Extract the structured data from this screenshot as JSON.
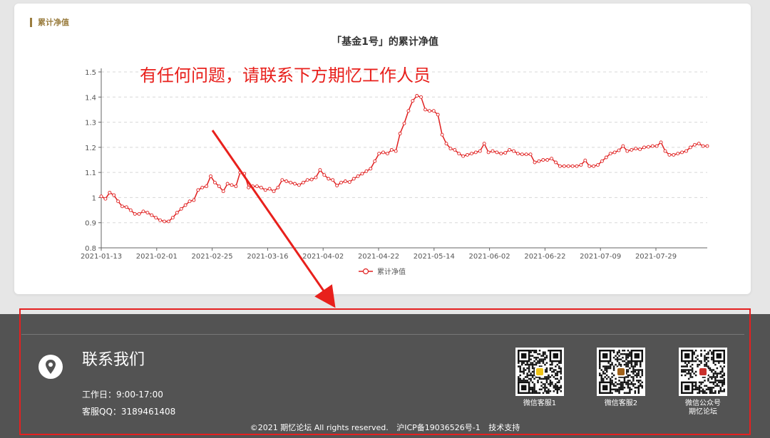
{
  "section": {
    "heading": "累计净值"
  },
  "annotation": {
    "text": "有任何问题，请联系下方期忆工作人员"
  },
  "colors": {
    "line": "#e02020",
    "accent": "#9a7d3f",
    "footer_bg": "#535353",
    "annotation": "#e8201c"
  },
  "chart_data": {
    "type": "line",
    "title": "「基金1号」的累计净值",
    "xlabel": "",
    "ylabel": "",
    "ylim": [
      0.8,
      1.5
    ],
    "yticks": [
      0.8,
      0.9,
      1,
      1.1,
      1.2,
      1.3,
      1.4,
      1.5
    ],
    "xticks": [
      "2021-01-13",
      "2021-02-01",
      "2021-02-25",
      "2021-03-16",
      "2021-04-02",
      "2021-04-22",
      "2021-05-14",
      "2021-06-02",
      "2021-06-22",
      "2021-07-09",
      "2021-07-29"
    ],
    "grid": true,
    "legend": "bottom-center",
    "series": [
      {
        "name": "累计净值",
        "values": [
          1.005,
          0.995,
          1.02,
          1.01,
          0.985,
          0.965,
          0.962,
          0.95,
          0.935,
          0.935,
          0.945,
          0.94,
          0.93,
          0.92,
          0.91,
          0.905,
          0.905,
          0.92,
          0.94,
          0.955,
          0.97,
          0.985,
          0.99,
          1.03,
          1.04,
          1.045,
          1.085,
          1.06,
          1.045,
          1.025,
          1.055,
          1.05,
          1.045,
          1.1,
          1.095,
          1.04,
          1.045,
          1.045,
          1.04,
          1.03,
          1.035,
          1.025,
          1.04,
          1.07,
          1.065,
          1.06,
          1.055,
          1.05,
          1.06,
          1.07,
          1.072,
          1.08,
          1.11,
          1.09,
          1.075,
          1.07,
          1.048,
          1.06,
          1.065,
          1.062,
          1.075,
          1.085,
          1.095,
          1.105,
          1.115,
          1.145,
          1.175,
          1.18,
          1.175,
          1.19,
          1.185,
          1.255,
          1.295,
          1.345,
          1.385,
          1.405,
          1.4,
          1.35,
          1.345,
          1.345,
          1.33,
          1.25,
          1.215,
          1.195,
          1.19,
          1.175,
          1.165,
          1.17,
          1.175,
          1.18,
          1.185,
          1.215,
          1.18,
          1.185,
          1.18,
          1.175,
          1.178,
          1.19,
          1.185,
          1.175,
          1.172,
          1.172,
          1.172,
          1.14,
          1.145,
          1.15,
          1.15,
          1.155,
          1.14,
          1.125,
          1.125,
          1.125,
          1.125,
          1.125,
          1.13,
          1.148,
          1.125,
          1.125,
          1.13,
          1.145,
          1.16,
          1.175,
          1.18,
          1.188,
          1.205,
          1.185,
          1.19,
          1.195,
          1.192,
          1.2,
          1.202,
          1.205,
          1.205,
          1.22,
          1.185,
          1.17,
          1.17,
          1.175,
          1.18,
          1.185,
          1.2,
          1.21,
          1.215,
          1.205,
          1.205
        ]
      }
    ]
  },
  "footer": {
    "contact_title": "联系我们",
    "hours": "工作日：9:00-17:00",
    "qq": "客服QQ：3189461408",
    "qr_codes": [
      {
        "label": "微信客服1",
        "badge": "#f0c419"
      },
      {
        "label": "微信客服2",
        "badge": "#a0621b"
      },
      {
        "label": "微信公众号\n期忆论坛",
        "badge": "#c9302c"
      }
    ],
    "copyright": "©2021 期忆论坛 All rights reserved.",
    "icp": "沪ICP备19036526号-1",
    "support": "技术支持"
  }
}
